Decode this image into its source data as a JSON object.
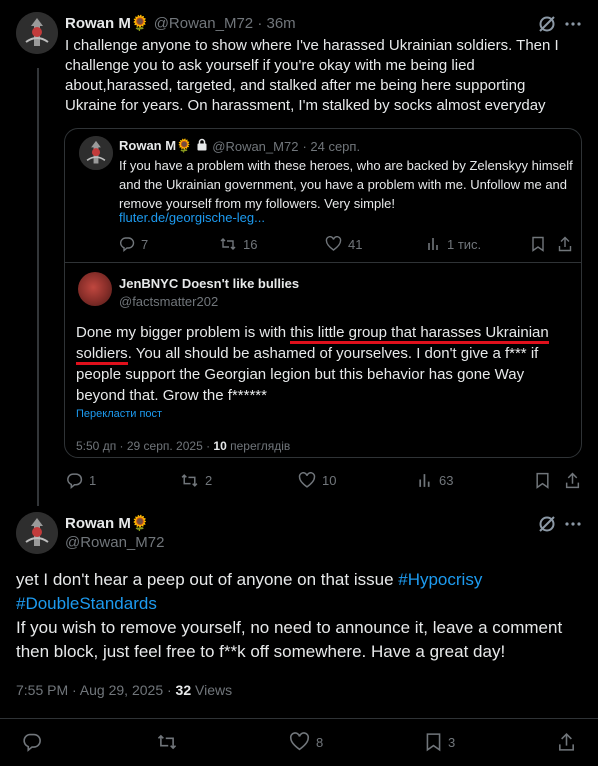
{
  "tweet1": {
    "name": "Rowan M🌻",
    "handle": "@Rowan_M72",
    "time": "· 36m",
    "text": "I challenge anyone to show where I've harassed Ukrainian soldiers. Then I challenge you to ask yourself if you're okay with me being lied about,harassed, targeted, and stalked after me being here supporting Ukraine for years. On harassment, I'm stalked by socks almost everyday",
    "stats": {
      "replies": "1",
      "reposts": "2",
      "likes": "10",
      "views": "63"
    }
  },
  "quote": {
    "name": "Rowan M🌻",
    "handle": "@Rowan_M72",
    "date": "· 24 серп.",
    "text": "If you have a problem with these heroes, who are backed by Zelenskyy himself and the Ukrainian government, you have a problem with me. Unfollow me and remove yourself from my followers. Very simple!",
    "link": "fluter.de/georgische-leg...",
    "stats": {
      "replies": "7",
      "reposts": "16",
      "likes": "41",
      "views": "1 тис."
    }
  },
  "nested": {
    "name": "JenBNYC Doesn't like bullies",
    "handle": "@factsmatter202",
    "text_pre": "Done  my bigger problem is with ",
    "text_underlined_1": "this little group that harasses Ukrainian",
    "text_underlined_2": "soldiers",
    "text_post": ". You all should be ashamed of yourselves. I don't give a f*** if people support the Georgian legion but this behavior has gone Way beyond that. Grow the f******",
    "translate": "Перекласти пост",
    "meta_time": "5:50 дп · 29 серп. 2025 · ",
    "meta_views_count": "10",
    "meta_views_label": " переглядів"
  },
  "tweet2": {
    "name": "Rowan M🌻",
    "handle": "@Rowan_M72",
    "text_pre": "yet I don't hear a peep out of anyone on that issue ",
    "hashtag1": "#Hypocrisy",
    "hashtag2": "#DoubleStandards",
    "text_post": "If you wish to remove yourself, no need to announce it, leave a comment then block, just feel free to f**k off somewhere. Have a great day!",
    "meta_time": "7:55 PM · Aug 29, 2025 · ",
    "meta_views_count": "32",
    "meta_views_label": " Views",
    "stats": {
      "replies": "",
      "reposts": "",
      "likes": "8",
      "bookmarks": "3"
    }
  },
  "colors": {
    "accent": "#1d9bf0",
    "underline": "#e0101c",
    "muted": "#71767b",
    "text": "#e7e9ea"
  },
  "icons": [
    "grok-icon",
    "more-icon",
    "lock-icon",
    "reply-icon",
    "repost-icon",
    "like-icon",
    "views-icon",
    "bookmark-icon",
    "share-icon"
  ]
}
